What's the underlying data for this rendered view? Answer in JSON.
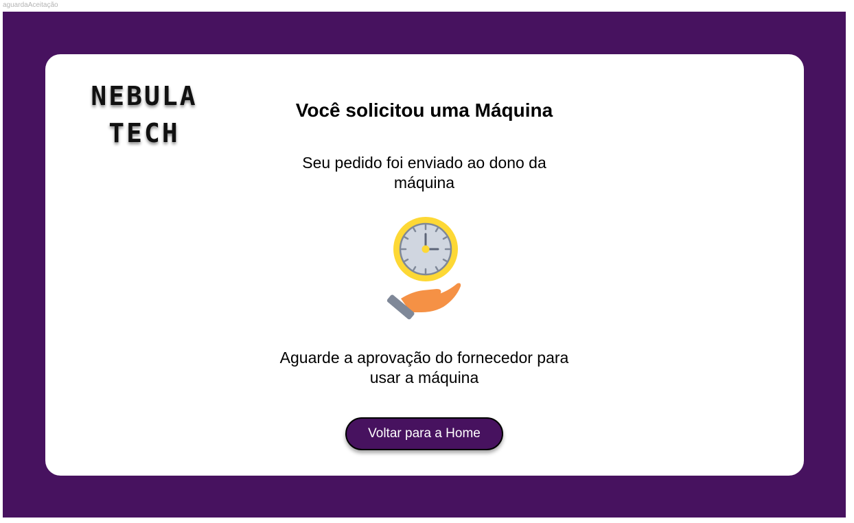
{
  "frame_label": "aguardaAceitação",
  "colors": {
    "background_purple": "#47125f",
    "card": "#ffffff",
    "button": "#47125f",
    "clock_ring": "#fdd835",
    "clock_face": "#d0d6e0",
    "hand": "#f59145",
    "sleeve": "#7f8898"
  },
  "logo": {
    "line1": "NEBULA",
    "line2": "TECH"
  },
  "title": "Você solicitou uma Máquina",
  "subtitle": "Seu pedido foi enviado ao dono da máquina",
  "illustration": {
    "icon": "clock-in-hand-icon"
  },
  "wait_message": "Aguarde a aprovação do fornecedor para usar a máquina",
  "home_button": {
    "label": "Voltar para a Home"
  }
}
